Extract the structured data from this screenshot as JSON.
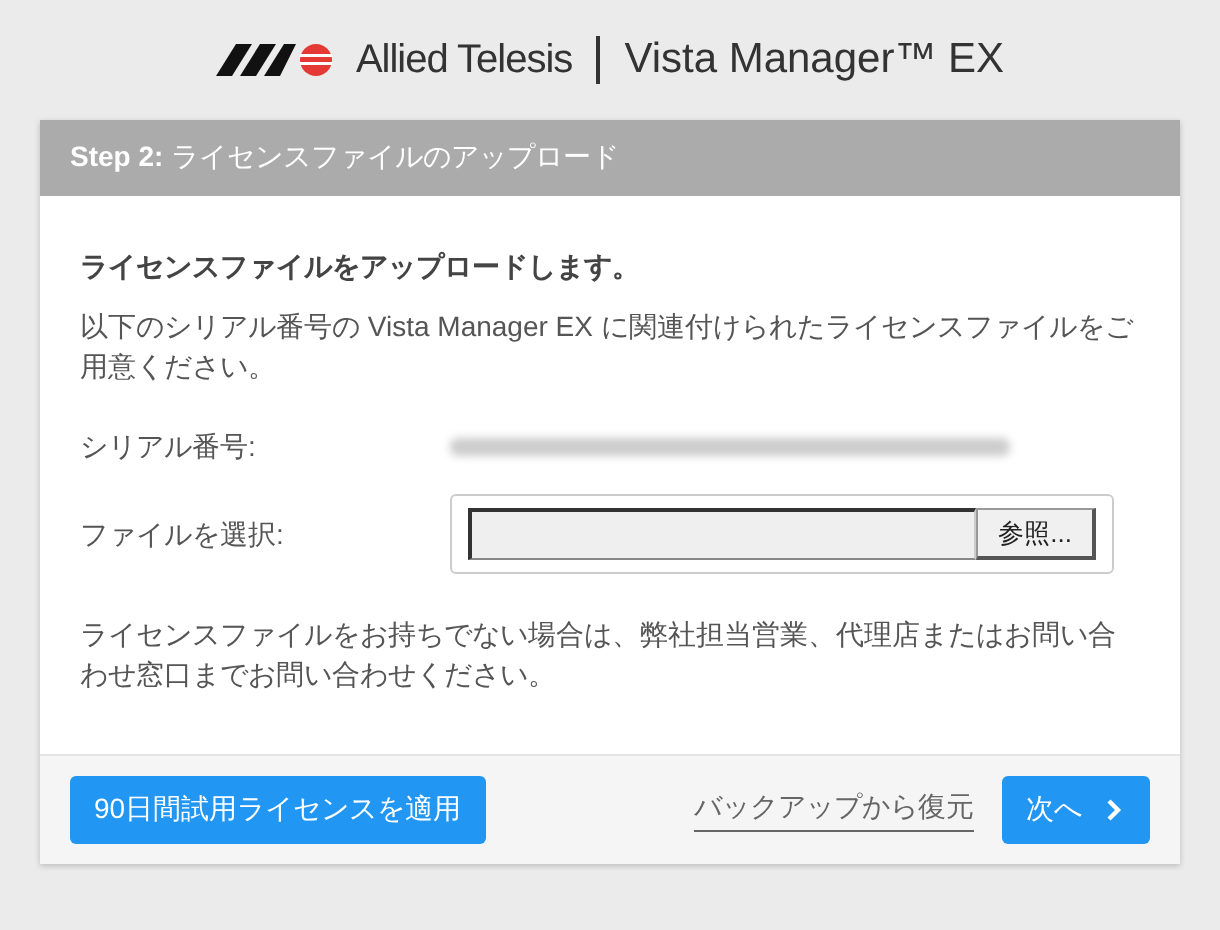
{
  "header": {
    "brand": "Allied Telesis",
    "product": "Vista Manager™ EX"
  },
  "card": {
    "title": "**Step 2:** ライセンスファイルのアップロード",
    "heading": "ライセンスファイルをアップロードします。",
    "intro": "以下のシリアル番号の Vista Manager EX に関連付けられたライセンスファイルをご用意ください。",
    "serial": {
      "label": "シリアル番号:"
    },
    "file": {
      "label": "ファイルを選択:",
      "browse": "参照..."
    },
    "note": "ライセンスファイルをお持ちでない場合は、弊社担当営業、代理店またはお問い合わせ窓口までお問い合わせください。"
  },
  "footer": {
    "trial_button": "90日間試用ライセンスを適用",
    "restore_link": "バックアップから復元",
    "next_button": "次へ"
  }
}
